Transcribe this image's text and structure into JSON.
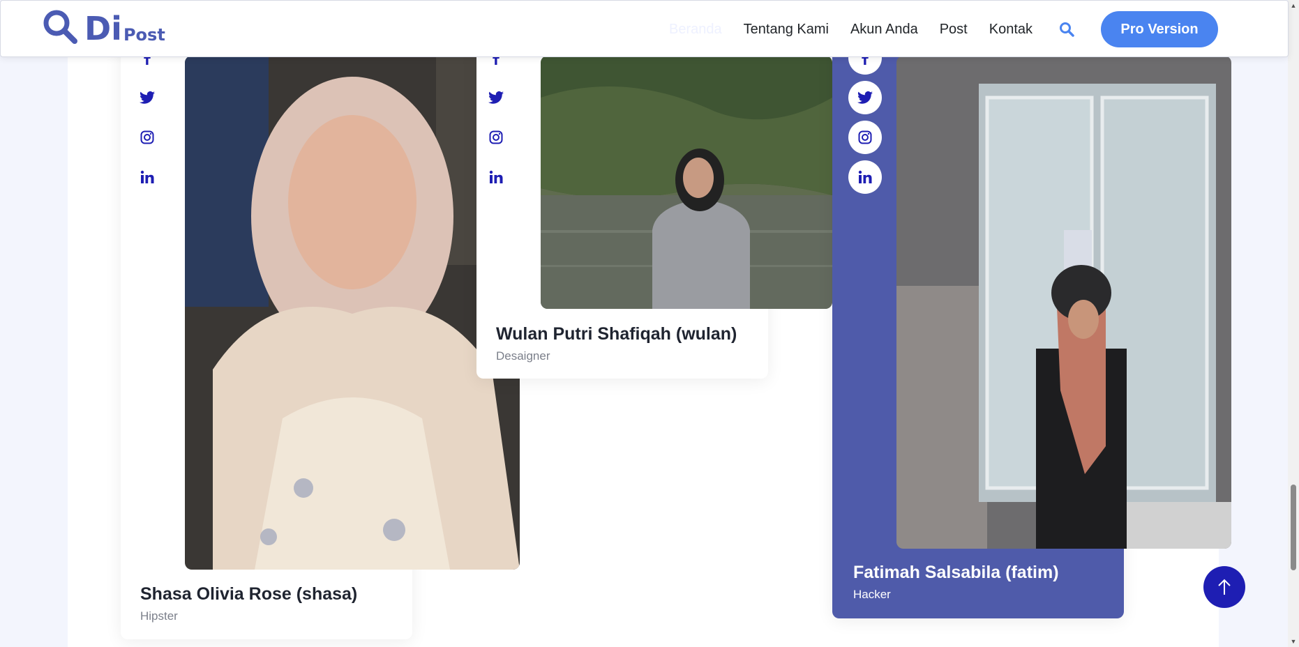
{
  "header": {
    "logo": {
      "big": "Di",
      "small": "Post"
    },
    "nav": [
      "Beranda",
      "Tentang Kami",
      "Akun Anda",
      "Post",
      "Kontak"
    ],
    "active_nav": "Beranda",
    "cta_label": "Pro Version"
  },
  "team": [
    {
      "name": "Shasa Olivia Rose (shasa)",
      "role": "Hipster"
    },
    {
      "name": "Wulan Putri Shafiqah (wulan)",
      "role": "Desaigner"
    },
    {
      "name": "Fatimah Salsabila (fatim)",
      "role": "Hacker"
    }
  ],
  "social_icons": [
    "facebook-icon",
    "twitter-icon",
    "instagram-icon",
    "linkedin-icon"
  ],
  "colors": {
    "brand": "#4b5bb3",
    "cta": "#4a84f0",
    "highlight_card": "#4f5baa",
    "social_icon": "#1e1eb3",
    "scroll_top": "#1e1eb3"
  }
}
